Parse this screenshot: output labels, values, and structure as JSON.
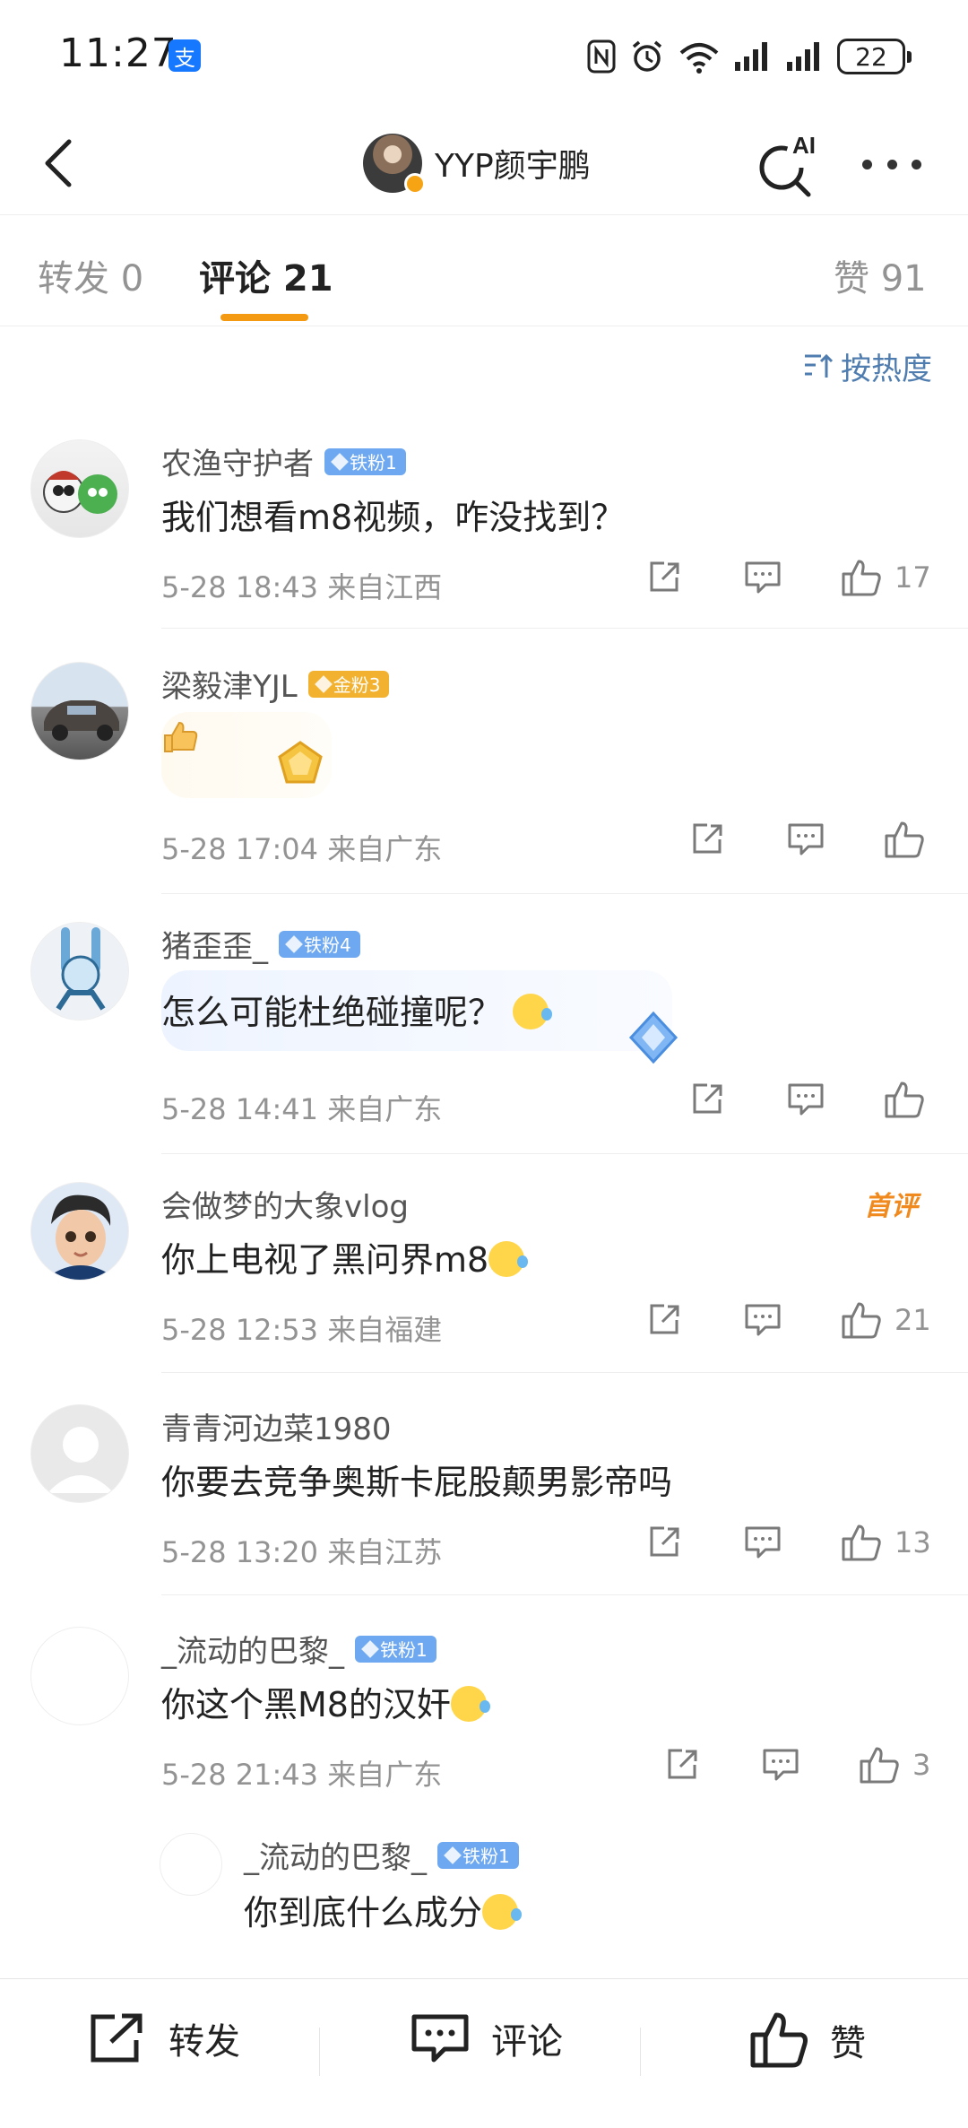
{
  "status_bar": {
    "time": "11:27",
    "pay_badge": "支",
    "battery": "22"
  },
  "nav": {
    "username": "YYP颜宇鹏",
    "ai_label": "AI"
  },
  "tabs": [
    {
      "label": "转发 0"
    },
    {
      "label": "评论 21"
    },
    {
      "label": "赞 91"
    }
  ],
  "sort_label": "按热度",
  "comments": [
    {
      "name": "农渔守护者",
      "badge": "铁粉1",
      "text": "我们想看m8视频，咋没找到？",
      "meta": "5-28 18:43  来自江西",
      "likes": "17"
    },
    {
      "name": "梁毅津YJL",
      "badge": "金粉3",
      "text": "",
      "meta": "5-28 17:04  来自广东",
      "likes": ""
    },
    {
      "name": "猪歪歪_",
      "badge": "铁粉4",
      "text": "怎么可能杜绝碰撞呢？",
      "meta": "5-28 14:41  来自广东",
      "likes": ""
    },
    {
      "name": "会做梦的大象vlog",
      "badge": "",
      "tag": "首评",
      "text": "你上电视了黑问界m8",
      "meta": "5-28 12:53  来自福建",
      "likes": "21"
    },
    {
      "name": "青青河边菜1980",
      "badge": "",
      "text": "你要去竞争奥斯卡屁股颠男影帝吗",
      "meta": "5-28 13:20  来自江苏",
      "likes": "13"
    },
    {
      "name": "_流动的巴黎_",
      "badge": "铁粉1",
      "text": "你这个黑M8的汉奸",
      "meta": "5-28 21:43  来自广东",
      "likes": "3"
    }
  ],
  "reply": {
    "name": "_流动的巴黎_",
    "badge": "铁粉1",
    "text": "你到底什么成分"
  },
  "bottom_bar": {
    "repost": "转发",
    "comment": "评论",
    "like": "赞"
  }
}
